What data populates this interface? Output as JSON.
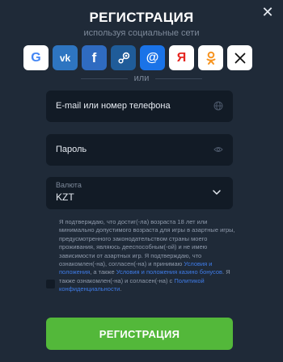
{
  "close": {
    "icon": "close-icon",
    "glyph": "✕"
  },
  "header": {
    "title": "РЕГИСТРАЦИЯ",
    "subtitle": "используя социальные сети"
  },
  "socials": [
    {
      "name": "google",
      "icon": "google-icon",
      "glyph": "G"
    },
    {
      "name": "vk",
      "icon": "vk-icon",
      "glyph": "vk"
    },
    {
      "name": "facebook",
      "icon": "facebook-icon",
      "glyph": "f"
    },
    {
      "name": "steam",
      "icon": "steam-icon",
      "glyph": "⚙"
    },
    {
      "name": "mail",
      "icon": "mail-ru-icon",
      "glyph": "@"
    },
    {
      "name": "yandex",
      "icon": "yandex-icon",
      "glyph": "Я"
    },
    {
      "name": "odnoklassniki",
      "icon": "odnoklassniki-icon",
      "glyph": "ok"
    },
    {
      "name": "x",
      "icon": "x-icon",
      "glyph": "X"
    }
  ],
  "divider": {
    "text": "или"
  },
  "form": {
    "email_placeholder": "E-mail или номер телефона",
    "password_placeholder": "Пароль",
    "currency_label": "Валюта",
    "currency_value": "KZT"
  },
  "terms": {
    "part1": "Я подтверждаю, что достиг(-ла) возраста 18 лет или минимально допустимого возраста для игры в азартные игры, предусмотренного законодательством страны моего проживания, являюсь дееспособным(-ой) и не имею зависимости от азартных игр. Я подтверждаю, что ознакомлен(-на), согласен(-на) и принимаю ",
    "link1": "Условия и положения",
    "part2": ", а также ",
    "link2": "Условия и положения казино бонусов",
    "part3": ". Я также ознакомлен(-на) и согласен(-на) с ",
    "link3": "Политикой конфиденциальности",
    "part4": "."
  },
  "submit": {
    "label": "РЕГИСТРАЦИЯ"
  },
  "colors": {
    "background": "#1f2a38",
    "field": "#121b26",
    "submit": "#53b83a",
    "link": "#3f7ce8"
  }
}
